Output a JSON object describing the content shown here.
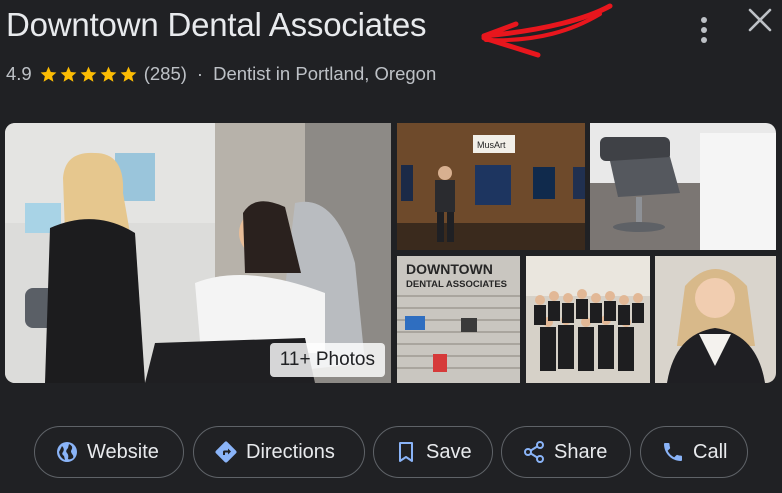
{
  "business": {
    "name": "Downtown Dental Associates",
    "rating": "4.9",
    "reviews": "(285)",
    "separator": "·",
    "category": "Dentist in Portland, Oregon"
  },
  "photos": {
    "count_label": "11+ Photos",
    "sign_line1": "DOWNTOWN",
    "sign_line2": "DENTAL ASSOCIATES",
    "wall_sign": "MusArt"
  },
  "actions": [
    {
      "label": "Website",
      "icon": "globe-icon"
    },
    {
      "label": "Directions",
      "icon": "directions-icon"
    },
    {
      "label": "Save",
      "icon": "bookmark-icon"
    },
    {
      "label": "Share",
      "icon": "share-icon"
    },
    {
      "label": "Call",
      "icon": "phone-icon"
    }
  ],
  "colors": {
    "background": "#202124",
    "star": "#fbbc04",
    "accent": "#8ab4f8",
    "annotation": "#e8161d"
  }
}
